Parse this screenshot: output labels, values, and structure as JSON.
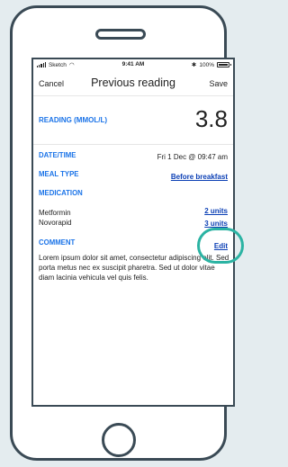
{
  "status_bar": {
    "carrier": "Sketch",
    "time": "9:41 AM",
    "battery": "100%",
    "wifi_icon": "wifi-icon",
    "bluetooth_icon": "bluetooth-icon"
  },
  "nav": {
    "cancel_label": "Cancel",
    "title": "Previous reading",
    "save_label": "Save"
  },
  "reading": {
    "label": "READING (MMOL/L)",
    "value": "3.8"
  },
  "datetime": {
    "label": "DATE/TIME",
    "value": "Fri 1 Dec @ 09:47 am"
  },
  "meal_type": {
    "label": "MEAL TYPE",
    "value": "Before breakfast"
  },
  "medication": {
    "label": "MEDICATION",
    "items": [
      {
        "name": "Metformin",
        "dose": "2 units"
      },
      {
        "name": "Novorapid",
        "dose": "3 units"
      }
    ]
  },
  "comment": {
    "label": "COMMENT",
    "edit_label": "Edit",
    "text": "Lorem ipsum dolor sit amet, consectetur adipiscing elit. Sed porta metus nec ex suscipit pharetra. Sed ut dolor vitae diam lacinia vehicula vel quis felis."
  },
  "colors": {
    "accent_label": "#1a73e8",
    "link": "#0b3fb5",
    "highlight": "#2bb3a3",
    "frame": "#3a4a55"
  }
}
